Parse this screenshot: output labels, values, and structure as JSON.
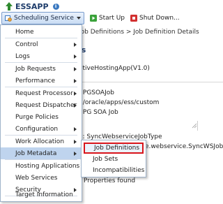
{
  "header": {
    "title": "ESSAPP",
    "info_icon_glyph": "i",
    "scheduling_button": "Scheduling Service",
    "start_up": "Start Up",
    "shut_down": "Shut Down..."
  },
  "page": {
    "breadcrumb": "Job Definitions > Job Definition Details",
    "subtitle": "ls",
    "application": "ativeHostingApp(V1.0)",
    "fields": {
      "name": ": PGSOAJob",
      "path": ": /oracle/apps/ess/custom",
      "display_name": ": PG SOA Job",
      "job_type": "e: SyncWebserviceJobType",
      "class": "e.webservice.SyncWSJob",
      "properties": "Properties found"
    }
  },
  "menu": {
    "items": [
      {
        "label": "Home",
        "has_submenu": false
      },
      {
        "label": "Control",
        "has_submenu": true
      },
      {
        "label": "Logs",
        "has_submenu": true
      },
      {
        "label": "Job Requests",
        "has_submenu": true
      },
      {
        "label": "Performance",
        "has_submenu": true
      },
      {
        "label": "Request Processor",
        "has_submenu": true
      },
      {
        "label": "Request Dispatcher",
        "has_submenu": true
      },
      {
        "label": "Purge Policies",
        "has_submenu": false
      },
      {
        "label": "Configuration",
        "has_submenu": true
      },
      {
        "label": "Work Allocation",
        "has_submenu": true
      },
      {
        "label": "Job Metadata",
        "has_submenu": true,
        "active": true
      },
      {
        "label": "Hosting Applications",
        "has_submenu": false
      },
      {
        "label": "Web Services",
        "has_submenu": false
      },
      {
        "label": "Security",
        "has_submenu": true
      },
      {
        "label": "Target Information",
        "has_submenu": false
      }
    ]
  },
  "submenu": {
    "items": [
      {
        "label": "Job Definitions",
        "highlighted": true
      },
      {
        "label": "Job Sets"
      },
      {
        "label": "Incompatibilities"
      }
    ]
  },
  "colors": {
    "menu_active": "#bfd4ee",
    "highlight_border": "#d8141b",
    "title": "#1f3d6b"
  }
}
